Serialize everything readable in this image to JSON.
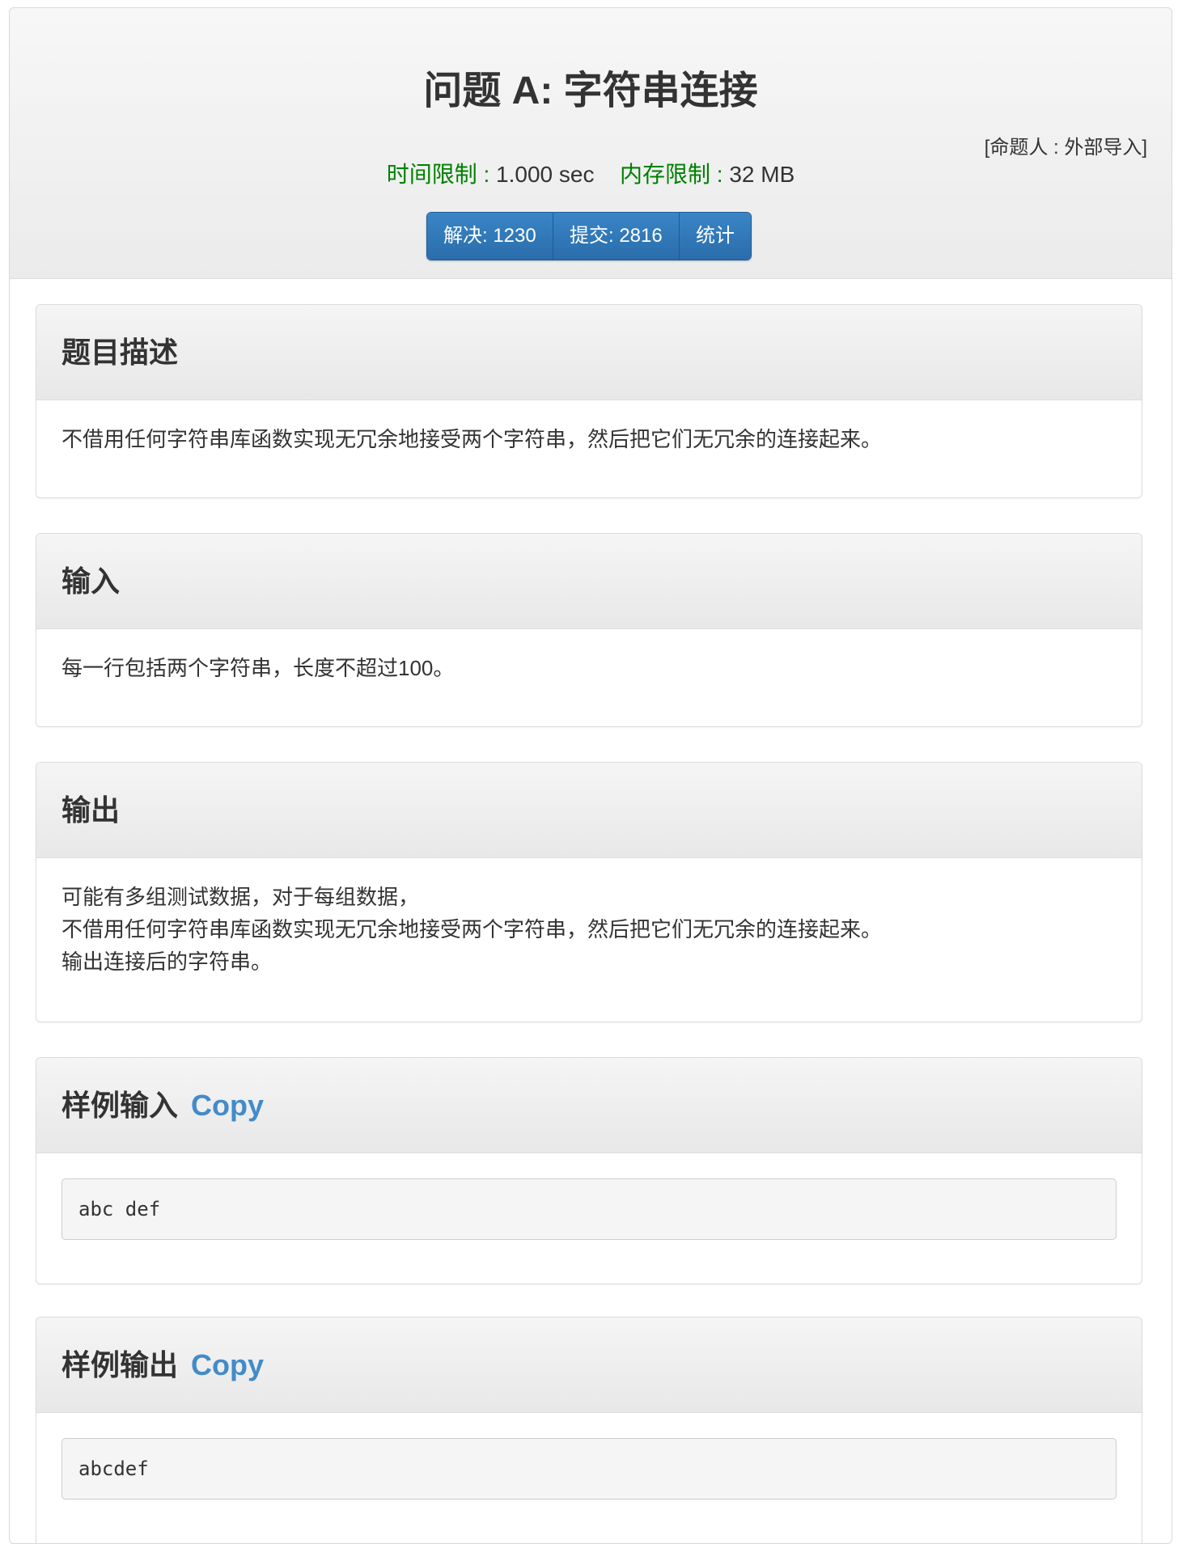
{
  "problem": {
    "title": "问题 A: 字符串连接",
    "author": "[命题人 : 外部导入]",
    "time_limit_label": "时间限制 :",
    "time_limit_value": "1.000 sec",
    "memory_limit_label": "内存限制 :",
    "memory_limit_value": "32 MB"
  },
  "stats": {
    "solved": "解决: 1230",
    "submitted": "提交: 2816",
    "statistics": "统计"
  },
  "sections": {
    "description": {
      "heading": "题目描述",
      "text": "不借用任何字符串库函数实现无冗余地接受两个字符串，然后把它们无冗余的连接起来。"
    },
    "input": {
      "heading": "输入",
      "text": "每一行包括两个字符串，长度不超过100。"
    },
    "output": {
      "heading": "输出",
      "lines": [
        "可能有多组测试数据，对于每组数据，",
        "不借用任何字符串库函数实现无冗余地接受两个字符串，然后把它们无冗余的连接起来。",
        "输出连接后的字符串。"
      ]
    },
    "sample_input": {
      "heading": "样例输入",
      "copy_label": "Copy",
      "code": "abc def"
    },
    "sample_output": {
      "heading": "样例输出",
      "copy_label": "Copy",
      "code": "abcdef"
    }
  }
}
